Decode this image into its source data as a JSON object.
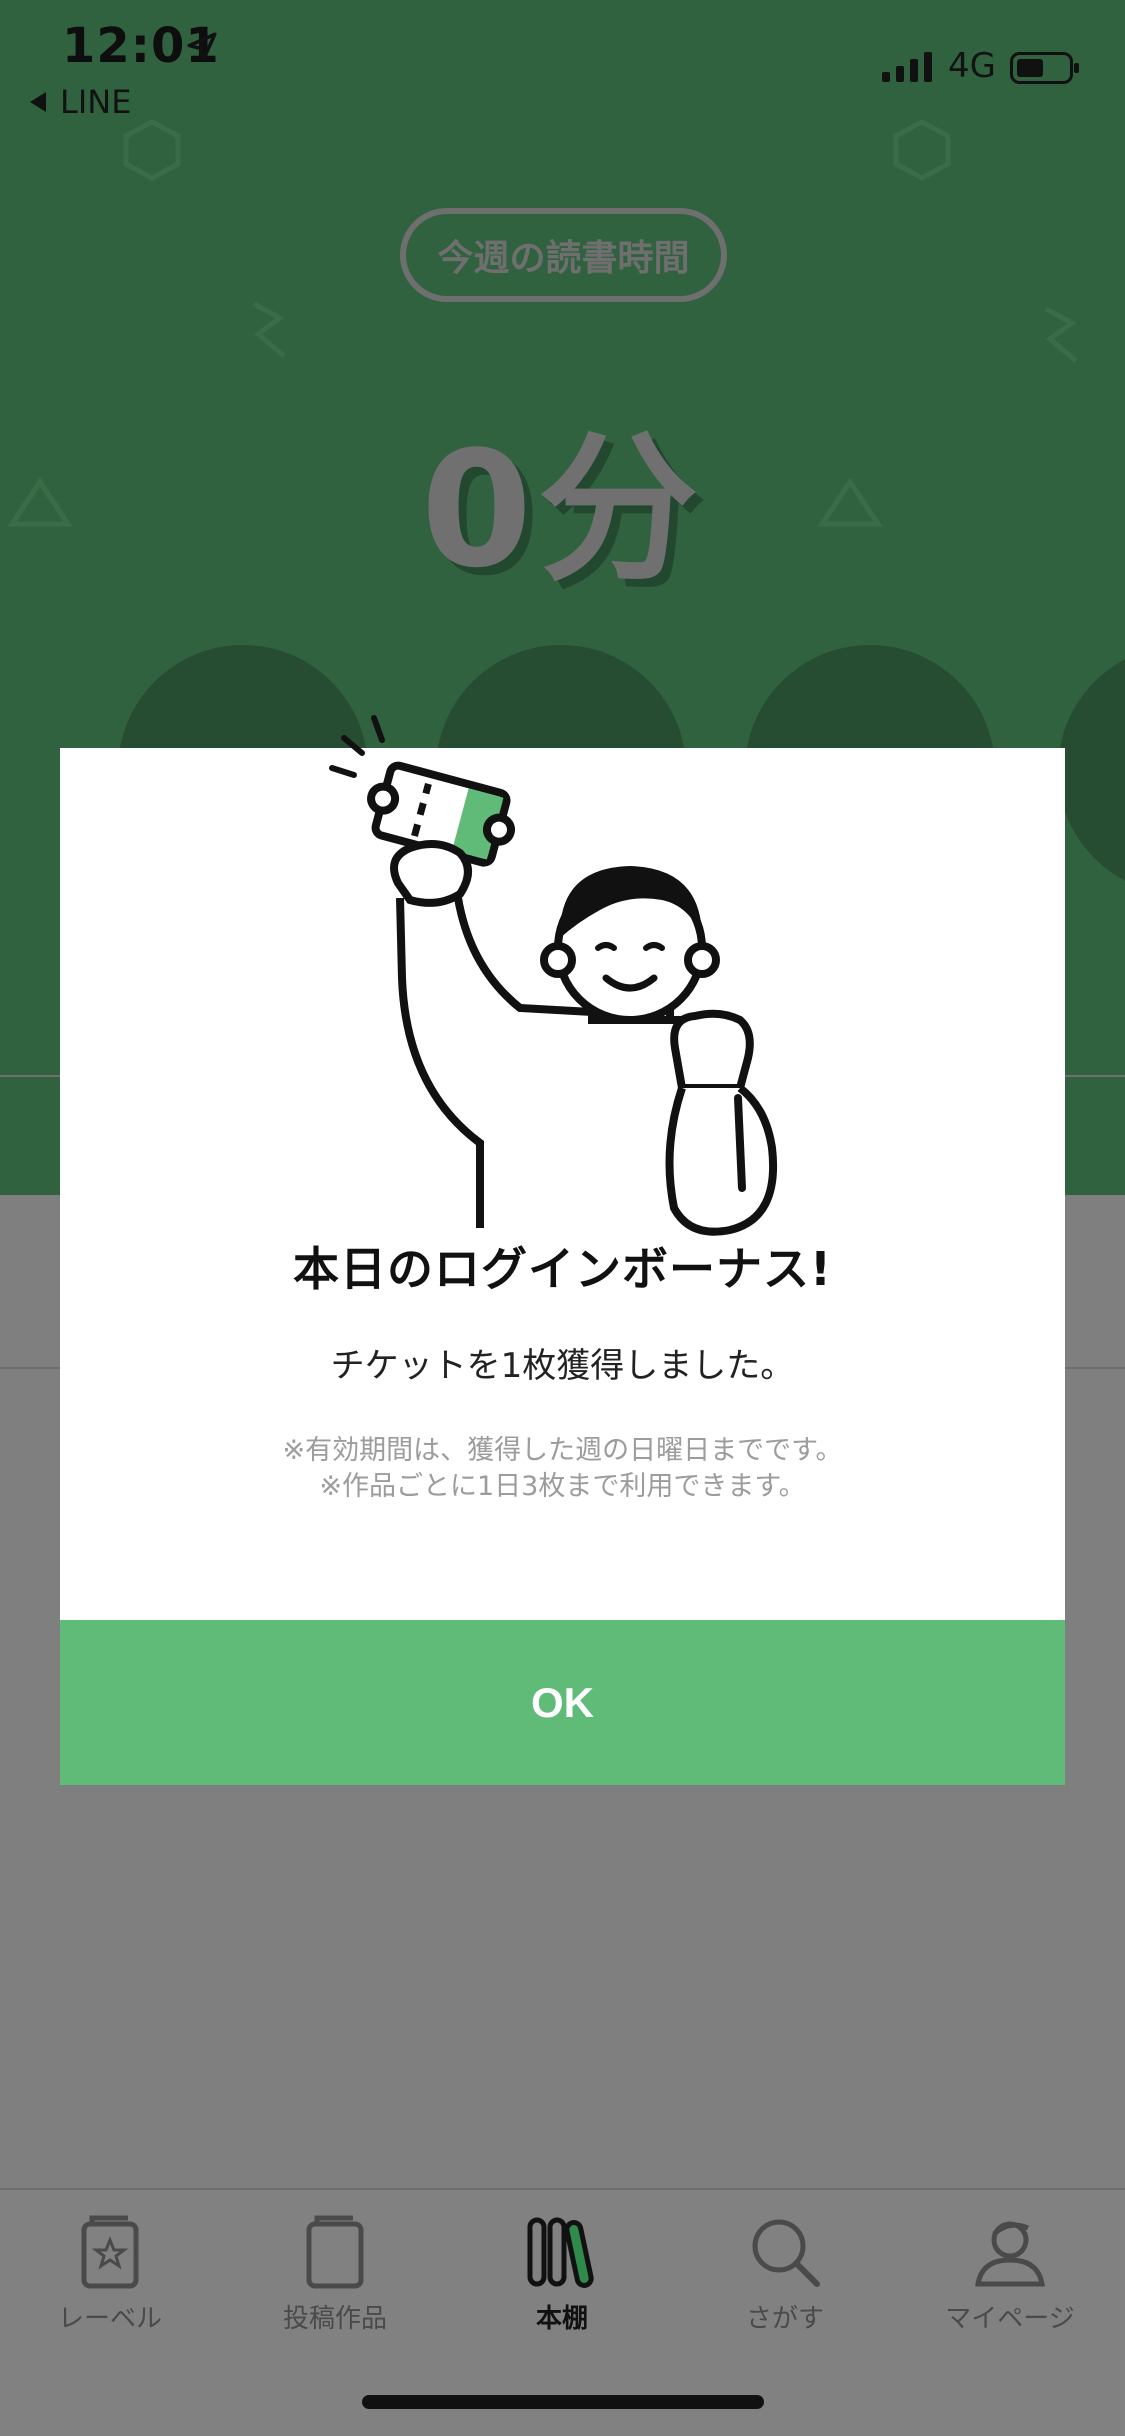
{
  "status_bar": {
    "time": "12:01",
    "back_app": "LINE",
    "network": "4G"
  },
  "hero": {
    "pill_label": "今週の読書時間",
    "minutes": "0分"
  },
  "tabbar": {
    "items": [
      {
        "label": "レーベル",
        "icon": "label-book-star-icon",
        "active": false
      },
      {
        "label": "投稿作品",
        "icon": "book-icon",
        "active": false
      },
      {
        "label": "本棚",
        "icon": "bookshelf-icon",
        "active": true
      },
      {
        "label": "さがす",
        "icon": "search-icon",
        "active": false
      },
      {
        "label": "マイページ",
        "icon": "person-icon",
        "active": false
      }
    ]
  },
  "modal": {
    "title": "本日のログインボーナス!",
    "message": "チケットを1枚獲得しました。",
    "note_1": "※有効期間は、獲得した週の日曜日までです。",
    "note_2": "※作品ごとに1日3枚まで利用できます。",
    "ok_label": "OK"
  },
  "colors": {
    "hero_green": "#316240",
    "accent_green": "#5fbb77",
    "overlay_gray": "#7f7f7f"
  }
}
